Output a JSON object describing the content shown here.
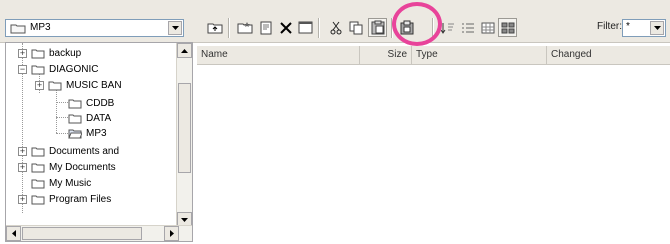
{
  "path_combo": {
    "value": "MP3"
  },
  "toolbar": {
    "buttons": [
      "up-folder",
      "new-folder",
      "properties",
      "delete",
      "new-window",
      "cut",
      "copy",
      "paste",
      "sort",
      "view-list",
      "view-details",
      "view-large"
    ]
  },
  "filter": {
    "label": "Filter:",
    "value": "*"
  },
  "tree": {
    "items": [
      {
        "label": "backup",
        "expander": "+"
      },
      {
        "label": "DIAGONIC",
        "expander": "−"
      },
      {
        "label": "MUSIC BAN",
        "expander": "+"
      },
      {
        "label": "CDDB",
        "expander": ""
      },
      {
        "label": "DATA",
        "expander": ""
      },
      {
        "label": "MP3",
        "expander": ""
      },
      {
        "label": "Documents and",
        "expander": "+"
      },
      {
        "label": "My Documents",
        "expander": "+"
      },
      {
        "label": "My Music",
        "expander": ""
      },
      {
        "label": "Program Files",
        "expander": "+"
      }
    ]
  },
  "list": {
    "columns": [
      "Name",
      "Size",
      "Type",
      "Changed"
    ]
  },
  "colors": {
    "highlight": "#e8439a",
    "chrome": "#ece9e2"
  }
}
